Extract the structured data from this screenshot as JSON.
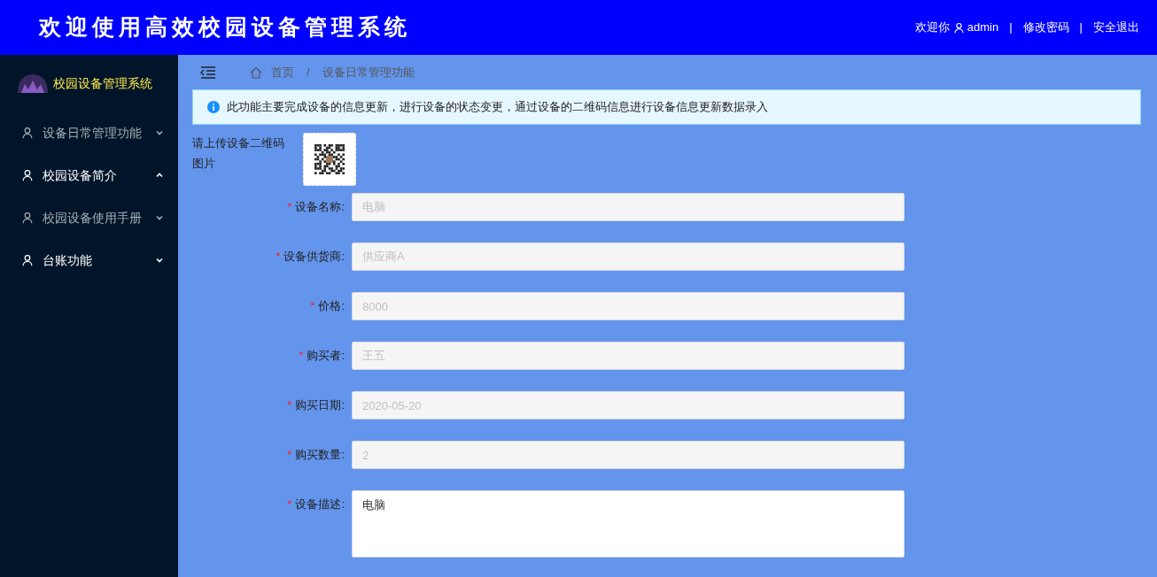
{
  "header": {
    "title": "欢迎使用高效校园设备管理系统",
    "welcome": "欢迎你",
    "user": "admin",
    "separator_1": "|",
    "change_password": "修改密码",
    "separator_2": "|",
    "logout": "安全退出"
  },
  "sidebar": {
    "brand": "校园设备管理系统",
    "items": [
      {
        "label": "设备日常管理功能",
        "expanded": false,
        "selected": false
      },
      {
        "label": "校园设备简介",
        "expanded": true,
        "selected": true
      },
      {
        "label": "校园设备使用手册",
        "expanded": false,
        "selected": false
      },
      {
        "label": "台账功能",
        "expanded": false,
        "selected": true
      }
    ]
  },
  "breadcrumb": {
    "home": "首页",
    "separator": "/",
    "current": "设备日常管理功能"
  },
  "alert": {
    "text": "此功能主要完成设备的信息更新，进行设备的状态变更，通过设备的二维码信息进行设备信息更新数据录入"
  },
  "upload": {
    "label": "请上传设备二维码图片"
  },
  "form": {
    "fields": [
      {
        "required_mark": "*",
        "label": "设备名称:",
        "kind": "input",
        "value": "电脑",
        "disabled": true
      },
      {
        "required_mark": "*",
        "label": "设备供货商:",
        "kind": "input",
        "value": "供应商A",
        "disabled": true
      },
      {
        "required_mark": "*",
        "label": "价格:",
        "kind": "input",
        "value": "8000",
        "disabled": true
      },
      {
        "required_mark": "*",
        "label": "购买者:",
        "kind": "input",
        "value": "王五",
        "disabled": true
      },
      {
        "required_mark": "*",
        "label": "购买日期:",
        "kind": "input",
        "value": "2020-05-20",
        "disabled": true
      },
      {
        "required_mark": "*",
        "label": "购买数量:",
        "kind": "input",
        "value": "2",
        "disabled": true
      },
      {
        "required_mark": "*",
        "label": "设备描述:",
        "kind": "textarea",
        "value": "电脑",
        "disabled": false
      }
    ]
  }
}
